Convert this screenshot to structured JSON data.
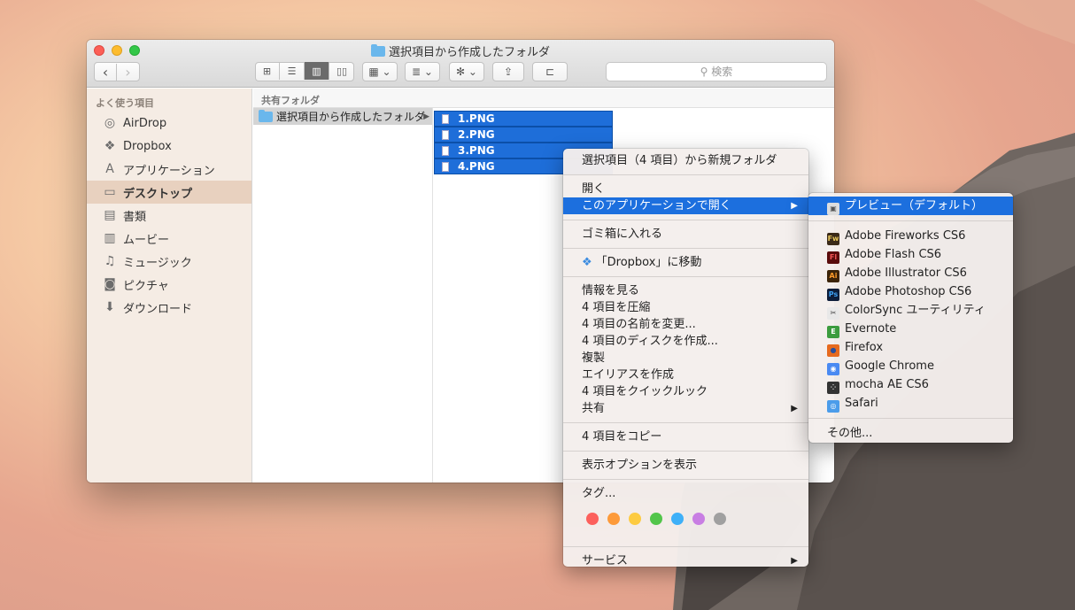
{
  "window": {
    "title": "選択項目から作成したフォルダ",
    "search_placeholder": "検索"
  },
  "toolbar": {
    "back": "‹",
    "forward": "›"
  },
  "sidebar": {
    "heading": "よく使う項目",
    "items": [
      {
        "label": "AirDrop",
        "icon": "airdrop-icon"
      },
      {
        "label": "Dropbox",
        "icon": "dropbox-icon"
      },
      {
        "label": "アプリケーション",
        "icon": "applications-icon"
      },
      {
        "label": "デスクトップ",
        "icon": "desktop-icon"
      },
      {
        "label": "書類",
        "icon": "documents-icon"
      },
      {
        "label": "ムービー",
        "icon": "movies-icon"
      },
      {
        "label": "ミュージック",
        "icon": "music-icon"
      },
      {
        "label": "ピクチャ",
        "icon": "pictures-icon"
      },
      {
        "label": "ダウンロード",
        "icon": "downloads-icon"
      }
    ]
  },
  "columns": {
    "header": "共有フォルダ",
    "folder": "選択項目から作成したフォルダ",
    "files": [
      "1.PNG",
      "2.PNG",
      "3.PNG",
      "4.PNG"
    ]
  },
  "context_menu": {
    "new_folder": "選択項目（4 項目）から新規フォルダ",
    "open": "開く",
    "open_with": "このアプリケーションで開く",
    "trash": "ゴミ箱に入れる",
    "move_dropbox": "「Dropbox」に移動",
    "group3": [
      "情報を見る",
      "4 項目を圧縮",
      "4 項目の名前を変更...",
      "4 項目のディスクを作成...",
      "複製",
      "エイリアスを作成",
      "4 項目をクイックルック"
    ],
    "share": "共有",
    "copy": "4 項目をコピー",
    "view_options": "表示オプションを表示",
    "tags": "タグ...",
    "tag_colors": [
      "#fc605c",
      "#fd9a39",
      "#fdcb41",
      "#52c54a",
      "#3eb0f8",
      "#c87ee3",
      "#a0a0a0"
    ],
    "services": "サービス"
  },
  "submenu": {
    "default_app": "プレビュー（デフォルト）",
    "apps": [
      {
        "label": "Adobe Fireworks CS6",
        "abbr": "Fw",
        "bg": "#3b2a18",
        "fg": "#e8c85d"
      },
      {
        "label": "Adobe Flash CS6",
        "abbr": "Fl",
        "bg": "#5a0c0c",
        "fg": "#f25555"
      },
      {
        "label": "Adobe Illustrator CS6",
        "abbr": "Ai",
        "bg": "#3c2408",
        "fg": "#ff9c2b"
      },
      {
        "label": "Adobe Photoshop CS6",
        "abbr": "Ps",
        "bg": "#0d1d3a",
        "fg": "#3ea1f4"
      },
      {
        "label": "ColorSync ユーティリティ",
        "abbr": "✂",
        "bg": "#e8e8e8",
        "fg": "#444"
      },
      {
        "label": "Evernote",
        "abbr": "E",
        "bg": "#3c9c3e",
        "fg": "#fff"
      },
      {
        "label": "Firefox",
        "abbr": "●",
        "bg": "#e66a1e",
        "fg": "#2a4e9a"
      },
      {
        "label": "Google Chrome",
        "abbr": "◉",
        "bg": "#4a8af2",
        "fg": "#fff"
      },
      {
        "label": "mocha AE CS6",
        "abbr": "⁘",
        "bg": "#333",
        "fg": "#ddd"
      },
      {
        "label": "Safari",
        "abbr": "◎",
        "bg": "#4b9cea",
        "fg": "#fff"
      }
    ],
    "other": "その他..."
  }
}
